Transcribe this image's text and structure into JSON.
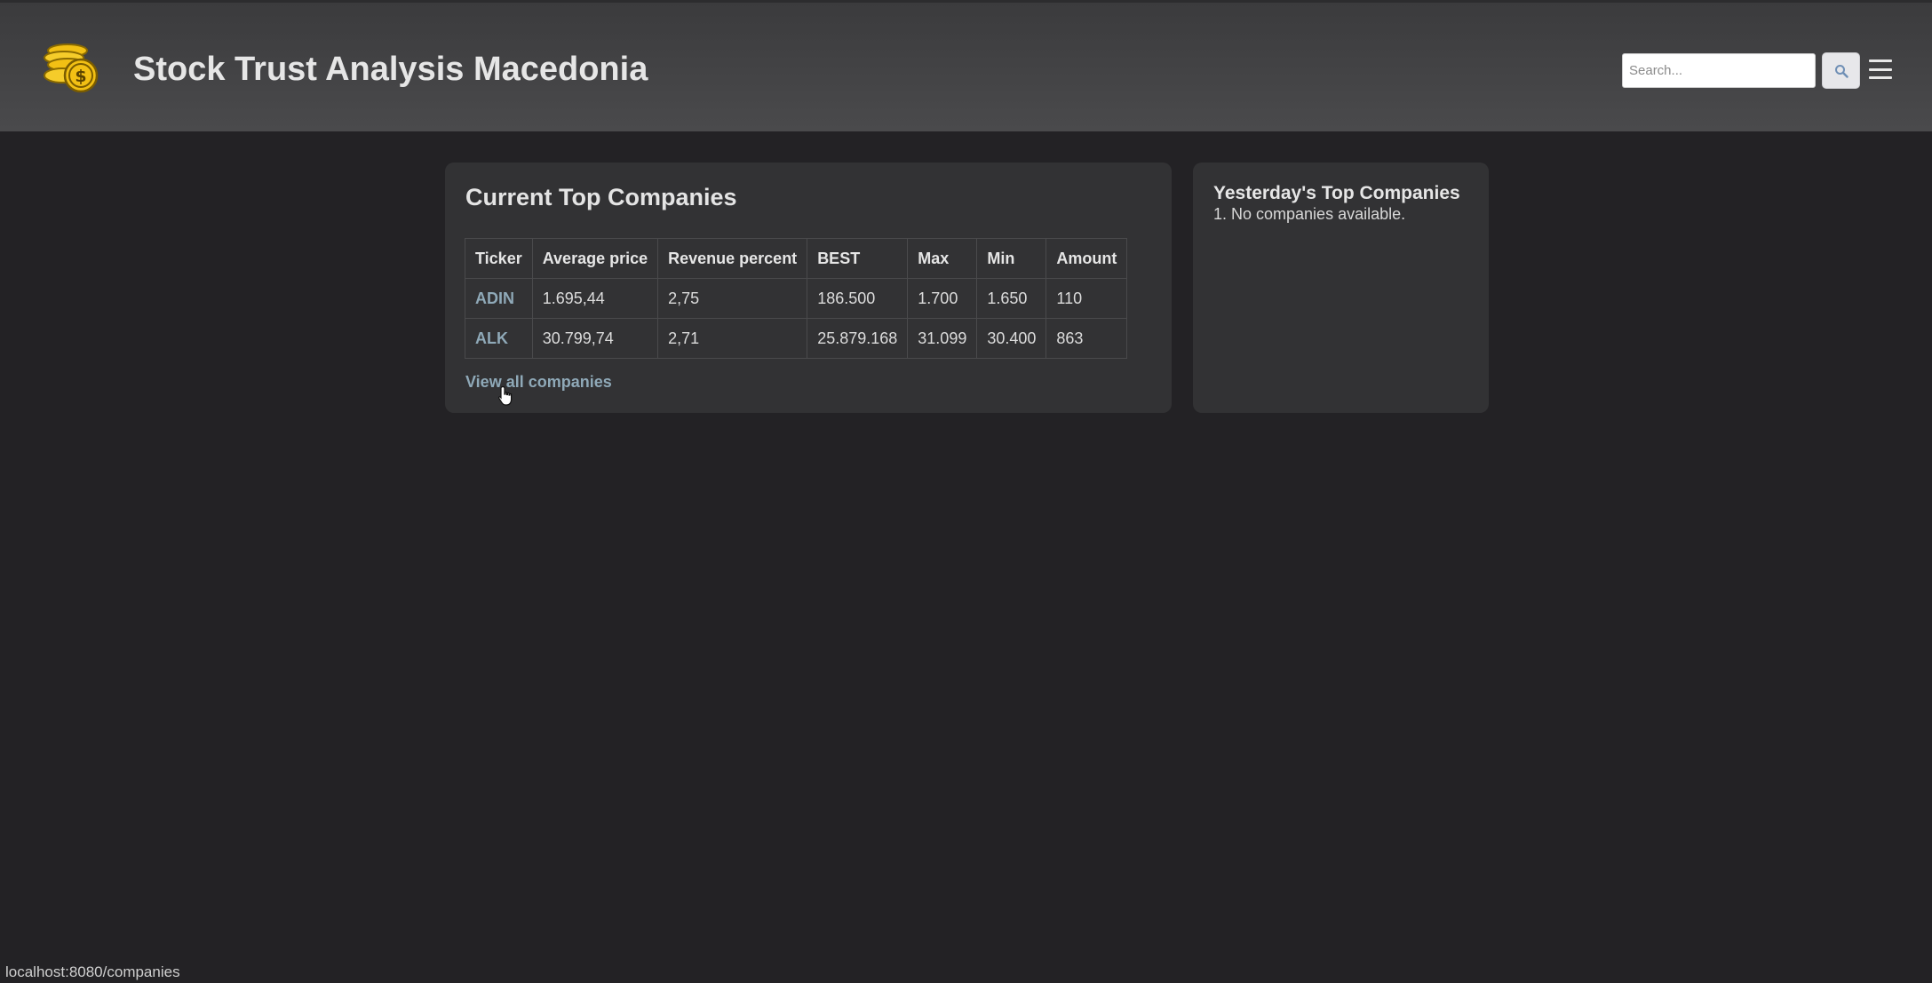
{
  "header": {
    "title": "Stock Trust Analysis Macedonia",
    "search_placeholder": "Search...",
    "search_icon": "magnifier-icon",
    "menu_icon": "hamburger-menu-icon",
    "logo_icon": "gold-coins-icon"
  },
  "current_top": {
    "title": "Current Top Companies",
    "columns": [
      "Ticker",
      "Average price",
      "Revenue percent",
      "BEST",
      "Max",
      "Min",
      "Amount"
    ],
    "rows": [
      [
        "ADIN",
        "1.695,44",
        "2,75",
        "186.500",
        "1.700",
        "1.650",
        "110"
      ],
      [
        "ALK",
        "30.799,74",
        "2,71",
        "25.879.168",
        "31.099",
        "30.400",
        "863"
      ]
    ],
    "view_all_label": "View all companies"
  },
  "yesterday_top": {
    "title": "Yesterday's Top Companies",
    "items": [
      "1. No companies available."
    ]
  },
  "status_bar": {
    "url": "localhost:8080/companies"
  },
  "colors": {
    "background": "#232225",
    "header": "#474749",
    "card": "#323234",
    "link": "#8fa9b8",
    "coin": "#f2c014"
  }
}
